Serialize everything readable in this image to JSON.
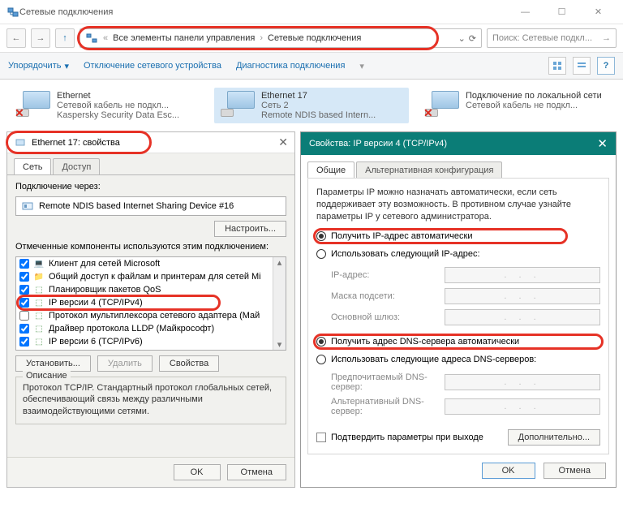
{
  "window": {
    "title": "Сетевые подключения",
    "minimize": "—",
    "maximize": "☐",
    "close": "✕"
  },
  "nav": {
    "back": "←",
    "forward": "→",
    "up": "↑",
    "crumb_sep1": "«",
    "crumb1": "Все элементы панели управления",
    "crumb_sep2": "›",
    "crumb2": "Сетевые подключения",
    "drop": "⌄",
    "refresh": "⟳",
    "search_placeholder": "Поиск: Сетевые подкл...",
    "search_icon": "🔍",
    "search_go": "→"
  },
  "cmdbar": {
    "organize": "Упорядочить",
    "disable": "Отключение сетевого устройства",
    "diagnose": "Диагностика подключения",
    "chev": "▾",
    "help": "?"
  },
  "connections": [
    {
      "name": "Ethernet",
      "line2": "Сетевой кабель не подкл...",
      "line3": "Kaspersky Security Data Esc...",
      "disconnected": true
    },
    {
      "name": "Ethernet 17",
      "line2": "Сеть 2",
      "line3": "Remote NDIS based Intern...",
      "selected": true
    },
    {
      "name": "Подключение по локальной сети",
      "line2": "Сетевой кабель не подкл...",
      "line3": "",
      "disconnected": true
    }
  ],
  "prop": {
    "title": "Ethernet 17: свойства",
    "close": "✕",
    "tab_net": "Сеть",
    "tab_access": "Доступ",
    "connect_via": "Подключение через:",
    "device": "Remote NDIS based Internet Sharing Device #16",
    "configure": "Настроить...",
    "components_label": "Отмеченные компоненты используются этим подключением:",
    "components": [
      "Клиент для сетей Microsoft",
      "Общий доступ к файлам и принтерам для сетей Mi",
      "Планировщик пакетов QoS",
      "IP версии 4 (TCP/IPv4)",
      "Протокол мультиплексора сетевого адаптера (Май",
      "Драйвер протокола LLDP (Майкрософт)",
      "IP версии 6 (TCP/IPv6)"
    ],
    "install": "Установить...",
    "remove": "Удалить",
    "properties": "Свойства",
    "desc_label": "Описание",
    "desc_text": "Протокол TCP/IP. Стандартный протокол глобальных сетей, обеспечивающий связь между различными взаимодействующими сетями.",
    "ok": "OK",
    "cancel": "Отмена"
  },
  "ipv4": {
    "title": "Свойства: IP версии 4 (TCP/IPv4)",
    "close": "✕",
    "tab_general": "Общие",
    "tab_alt": "Альтернативная конфигурация",
    "intro": "Параметры IP можно назначать автоматически, если сеть поддерживает эту возможность. В противном случае узнайте параметры IP у сетевого администратора.",
    "r_auto_ip": "Получить IP-адрес автоматически",
    "r_manual_ip": "Использовать следующий IP-адрес:",
    "f_ip": "IP-адрес:",
    "f_mask": "Маска подсети:",
    "f_gw": "Основной шлюз:",
    "r_auto_dns": "Получить адрес DNS-сервера автоматически",
    "r_manual_dns": "Использовать следующие адреса DNS-серверов:",
    "f_dns1": "Предпочитаемый DNS-сервер:",
    "f_dns2": "Альтернативный DNS-сервер:",
    "ip_placeholder": ". . .",
    "confirm": "Подтвердить параметры при выходе",
    "advanced": "Дополнительно...",
    "ok": "OK",
    "cancel": "Отмена"
  }
}
